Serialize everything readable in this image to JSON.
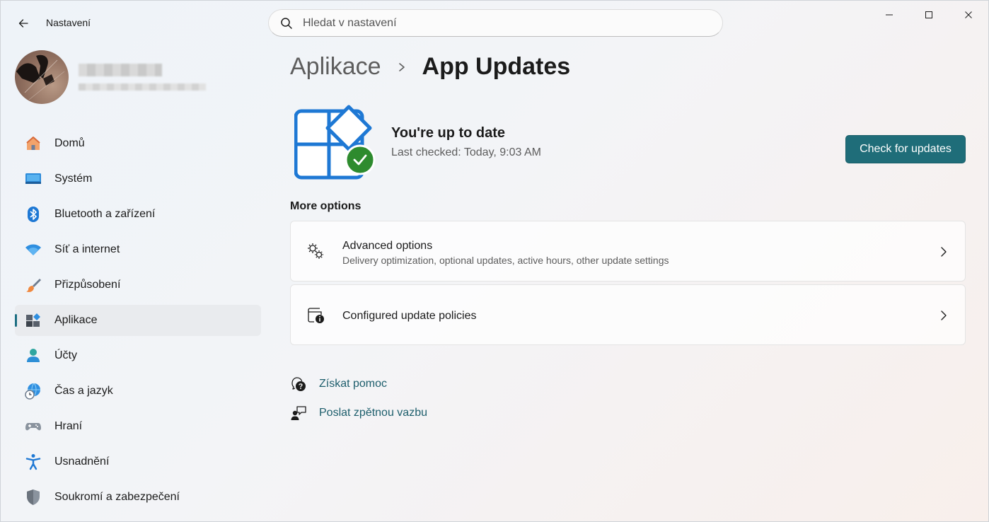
{
  "window": {
    "app_title": "Nastavení",
    "controls": {
      "minimize": "minimize-icon",
      "maximize": "maximize-icon",
      "close": "close-icon"
    }
  },
  "search": {
    "placeholder": "Hledat v nastavení",
    "value": ""
  },
  "sidebar": {
    "items": [
      {
        "label": "Domů",
        "icon": "home-icon",
        "active": false
      },
      {
        "label": "Systém",
        "icon": "monitor-icon",
        "active": false
      },
      {
        "label": "Bluetooth a zařízení",
        "icon": "bluetooth-icon",
        "active": false
      },
      {
        "label": "Síť a internet",
        "icon": "wifi-icon",
        "active": false
      },
      {
        "label": "Přizpůsobení",
        "icon": "brush-icon",
        "active": false
      },
      {
        "label": "Aplikace",
        "icon": "apps-icon",
        "active": true
      },
      {
        "label": "Účty",
        "icon": "person-icon",
        "active": false
      },
      {
        "label": "Čas a jazyk",
        "icon": "globe-clock-icon",
        "active": false
      },
      {
        "label": "Hraní",
        "icon": "gamepad-icon",
        "active": false
      },
      {
        "label": "Usnadnění",
        "icon": "accessibility-icon",
        "active": false
      },
      {
        "label": "Soukromí a zabezpečení",
        "icon": "shield-icon",
        "active": false
      }
    ]
  },
  "breadcrumb": {
    "parent": "Aplikace",
    "current": "App Updates"
  },
  "status": {
    "title": "You're up to date",
    "subtitle": "Last checked: Today, 9:03 AM",
    "button": "Check for updates"
  },
  "more_options": {
    "title": "More options",
    "items": [
      {
        "title": "Advanced options",
        "description": "Delivery optimization, optional updates, active hours, other update settings",
        "icon": "gears-icon"
      },
      {
        "title": "Configured update policies",
        "description": "",
        "icon": "policy-info-icon"
      }
    ]
  },
  "links": [
    {
      "label": "Získat pomoc",
      "icon": "help-icon"
    },
    {
      "label": "Poslat zpětnou vazbu",
      "icon": "feedback-icon"
    }
  ],
  "colors": {
    "accent": "#1f6d79",
    "link": "#1d5e6c",
    "success": "#2e8b2e",
    "tile_blue": "#1e78d4"
  }
}
